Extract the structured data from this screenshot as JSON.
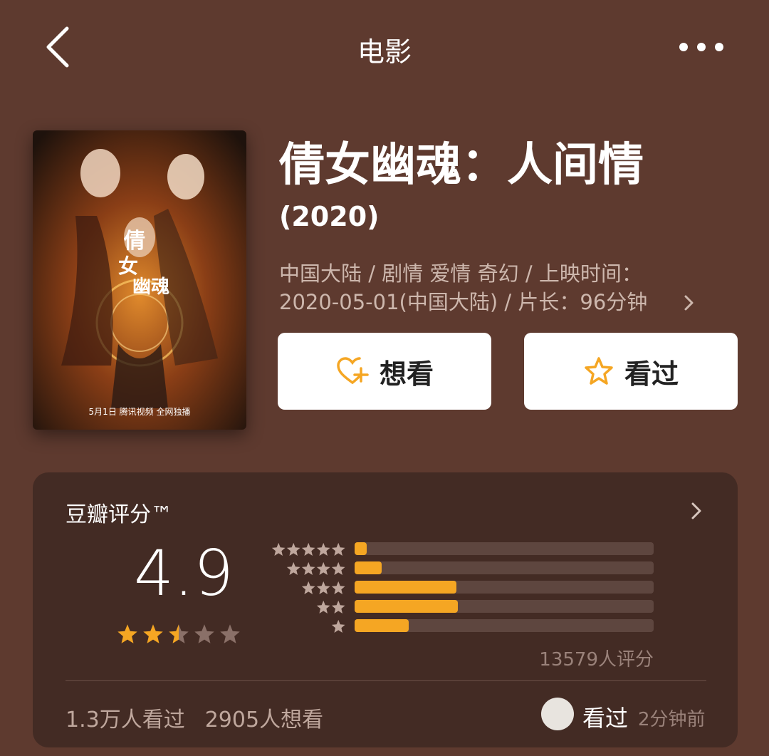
{
  "nav": {
    "title": "电影",
    "back_icon": "chevron-left-icon",
    "more_icon": "more-dots-icon"
  },
  "poster": {
    "date_text": "5月1日 腾讯视频 全网独播"
  },
  "movie": {
    "title": "倩女幽魂：人间情",
    "year": "(2020)",
    "meta_line1": "中国大陆 / 剧情 爱情 奇幻 / 上映时间：",
    "meta_line2": "2020-05-01(中国大陆) / 片长：96分钟"
  },
  "actions": {
    "want_label": "想看",
    "want_icon": "heart-plus-icon",
    "seen_label": "看过",
    "seen_icon": "star-outline-icon",
    "accent": "#f5a623"
  },
  "rating": {
    "title": "豆瓣评分™",
    "score": "4.9",
    "stars_value": 2.5,
    "stars_max": 5,
    "distribution": [
      {
        "stars": 5,
        "fraction": 0.04
      },
      {
        "stars": 4,
        "fraction": 0.09
      },
      {
        "stars": 3,
        "fraction": 0.34
      },
      {
        "stars": 2,
        "fraction": 0.345
      },
      {
        "stars": 1,
        "fraction": 0.18
      }
    ],
    "count_text": "13579人评分",
    "watched_text": "1.3万人看过",
    "wish_text": "2905人想看",
    "friend_action": "看过",
    "friend_time": "2分钟前"
  },
  "colors": {
    "background": "#5e3a2f",
    "card": "#432b24",
    "star": "#f5a623",
    "star_empty": "#8a7068"
  }
}
